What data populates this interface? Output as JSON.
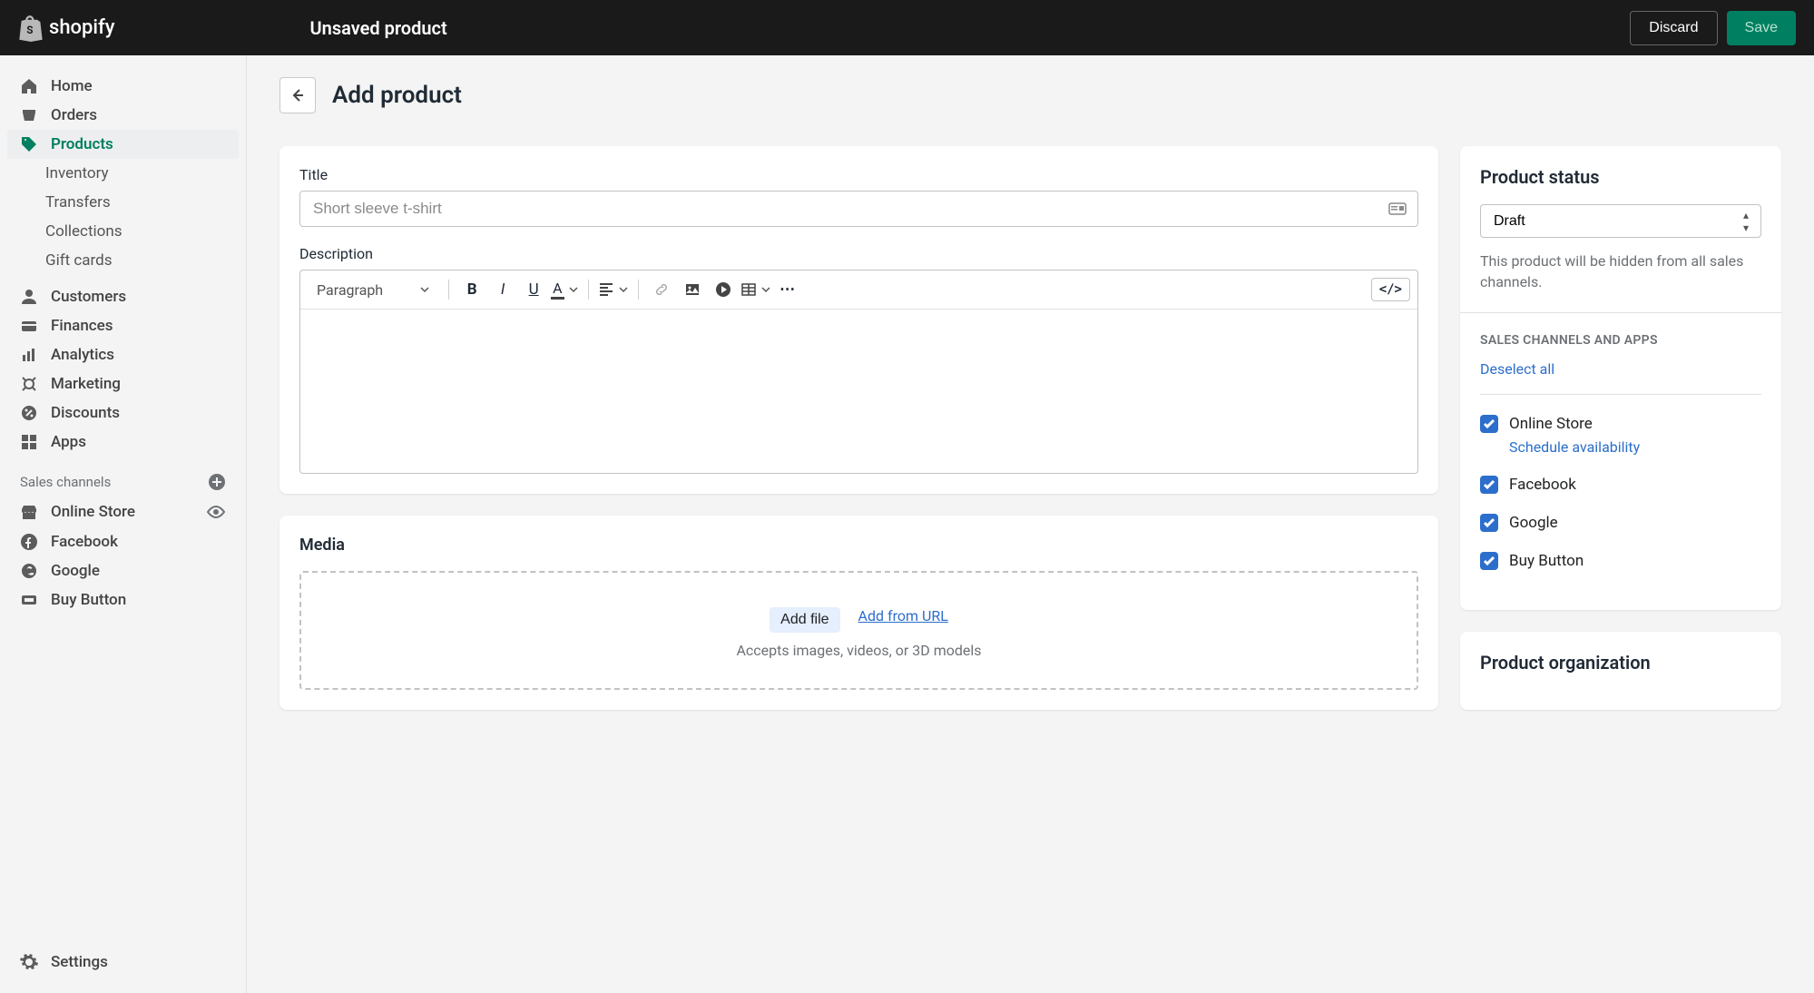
{
  "topbar": {
    "brand": "shopify",
    "title": "Unsaved product",
    "discard": "Discard",
    "save": "Save"
  },
  "sidebar": {
    "items": [
      {
        "label": "Home",
        "icon": "home-icon"
      },
      {
        "label": "Orders",
        "icon": "orders-icon"
      },
      {
        "label": "Products",
        "icon": "products-icon",
        "active": true
      },
      {
        "label": "Customers",
        "icon": "customers-icon"
      },
      {
        "label": "Finances",
        "icon": "finances-icon"
      },
      {
        "label": "Analytics",
        "icon": "analytics-icon"
      },
      {
        "label": "Marketing",
        "icon": "marketing-icon"
      },
      {
        "label": "Discounts",
        "icon": "discounts-icon"
      },
      {
        "label": "Apps",
        "icon": "apps-icon"
      }
    ],
    "products_sub": [
      "Inventory",
      "Transfers",
      "Collections",
      "Gift cards"
    ],
    "channels_heading": "Sales channels",
    "channels": [
      {
        "label": "Online Store"
      },
      {
        "label": "Facebook"
      },
      {
        "label": "Google"
      },
      {
        "label": "Buy Button"
      }
    ],
    "settings": "Settings"
  },
  "page": {
    "title": "Add product"
  },
  "form": {
    "title_label": "Title",
    "title_placeholder": "Short sleeve t-shirt",
    "description_label": "Description",
    "paragraph_select": "Paragraph"
  },
  "media": {
    "heading": "Media",
    "add_file": "Add file",
    "add_from_url": "Add from URL",
    "hint": "Accepts images, videos, or 3D models"
  },
  "status": {
    "heading": "Product status",
    "value": "Draft",
    "hint": "This product will be hidden from all sales channels.",
    "channels_heading": "SALES CHANNELS AND APPS",
    "deselect_all": "Deselect all",
    "channel_list": [
      {
        "label": "Online Store",
        "schedule": "Schedule availability"
      },
      {
        "label": "Facebook"
      },
      {
        "label": "Google"
      },
      {
        "label": "Buy Button"
      }
    ],
    "accent": "#2c6ecb"
  },
  "organization": {
    "heading": "Product organization"
  }
}
